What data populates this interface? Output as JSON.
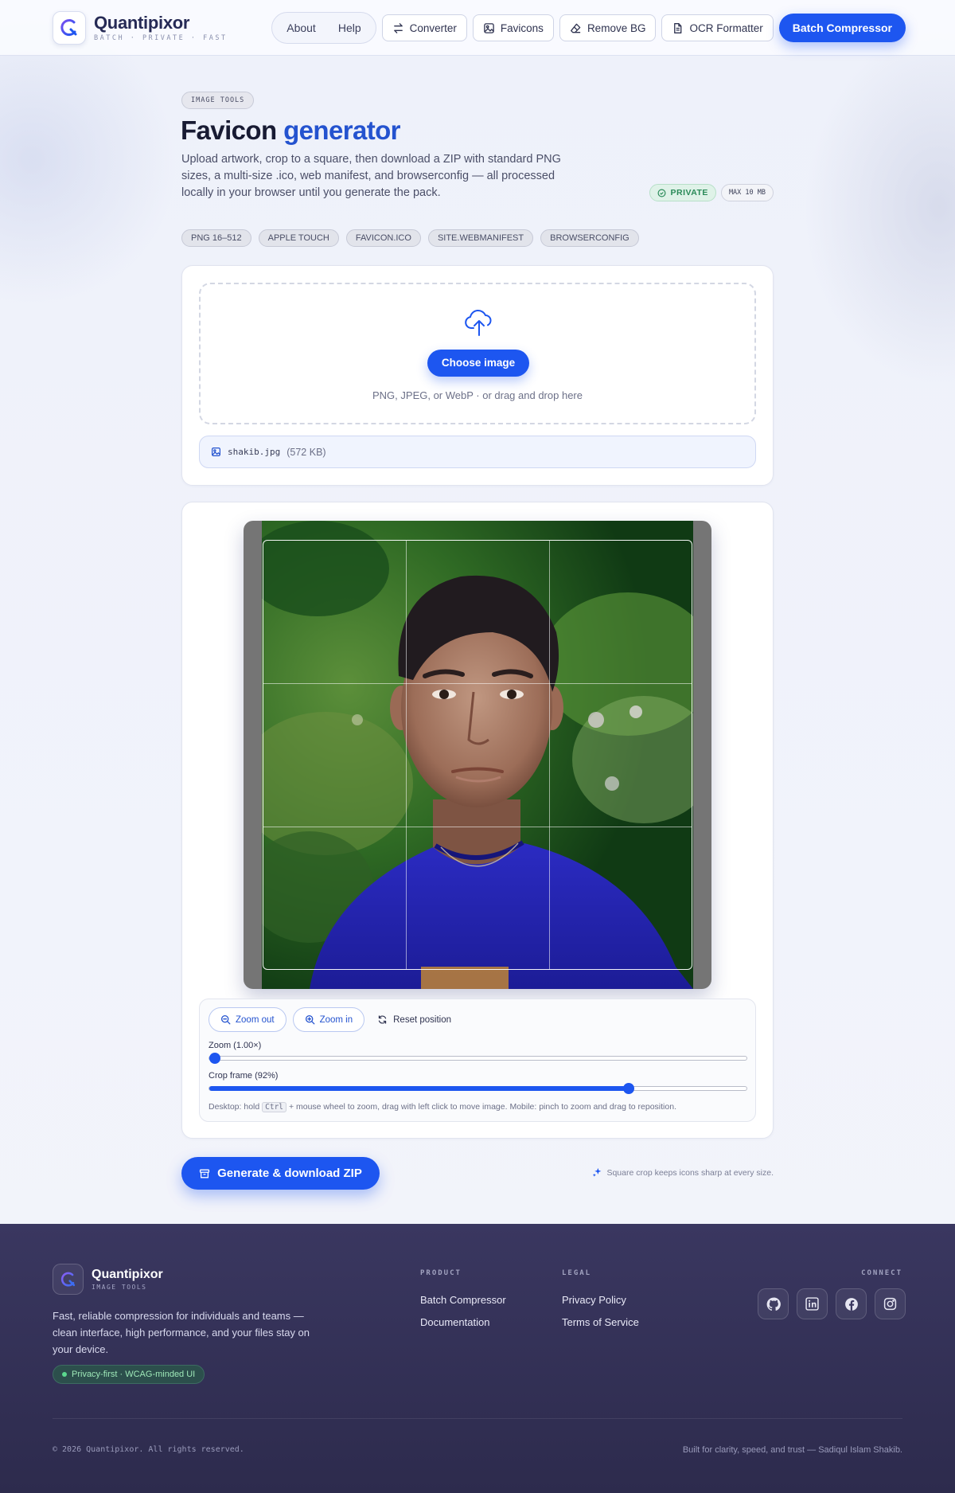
{
  "header": {
    "brand_name": "Quantipixor",
    "brand_tagline": "BATCH · PRIVATE · FAST",
    "nav_links": [
      {
        "label": "About"
      },
      {
        "label": "Help"
      }
    ],
    "tools": [
      {
        "label": "Converter",
        "icon": "swap-arrows-icon"
      },
      {
        "label": "Favicons",
        "icon": "image-icon"
      },
      {
        "label": "Remove BG",
        "icon": "eraser-icon"
      },
      {
        "label": "OCR Formatter",
        "icon": "document-icon"
      }
    ],
    "cta_label": "Batch Compressor"
  },
  "hero": {
    "badge": "IMAGE TOOLS",
    "title_main": "Favicon",
    "title_accent": "generator",
    "description": "Upload artwork, crop to a square, then download a ZIP with standard PNG sizes, a multi-size .ico, web manifest, and browserconfig — all processed locally in your browser until you generate the pack.",
    "status_private": "PRIVATE",
    "status_max": "MAX 10 MB",
    "chips": [
      "PNG 16–512",
      "APPLE TOUCH",
      "FAVICON.ICO",
      "SITE.WEBMANIFEST",
      "BROWSERCONFIG"
    ]
  },
  "upload": {
    "choose_label": "Choose image",
    "hint": "PNG, JPEG, or WebP · or drag and drop here",
    "file_name": "shakib.jpg",
    "file_size": "(572 KB)"
  },
  "crop": {
    "zoom_out_label": "Zoom out",
    "zoom_in_label": "Zoom in",
    "reset_label": "Reset position",
    "zoom_label": "Zoom (1.00×)",
    "zoom_value": 0,
    "frame_label": "Crop frame (92%)",
    "frame_value": 0.78,
    "hint_before": "Desktop: hold",
    "hint_key": "Ctrl",
    "hint_after": "+ mouse wheel to zoom, drag with left click to move image. Mobile: pinch to zoom and drag to reposition."
  },
  "actions": {
    "generate_label": "Generate & download ZIP",
    "tagline": "Square crop keeps icons sharp at every size."
  },
  "footer": {
    "brand_name": "Quantipixor",
    "brand_sub": "IMAGE TOOLS",
    "description": "Fast, reliable compression for individuals and teams — clean interface, high performance, and your files stay on your device.",
    "badge": "Privacy-first · WCAG-minded UI",
    "product_title": "PRODUCT",
    "product_links": [
      "Batch Compressor",
      "Documentation"
    ],
    "legal_title": "LEGAL",
    "legal_links": [
      "Privacy Policy",
      "Terms of Service"
    ],
    "connect_title": "CONNECT",
    "social": [
      "github-icon",
      "linkedin-icon",
      "facebook-icon",
      "instagram-icon"
    ],
    "copyright": "© 2026 Quantipixor. All rights reserved.",
    "built": "Built for clarity, speed, and trust — Sadiqul Islam Shakib."
  },
  "colors": {
    "accent": "#1d56f0",
    "accent_text": "#2453cf",
    "footer_bg": "#34325a",
    "private_green": "#2a8a58"
  }
}
